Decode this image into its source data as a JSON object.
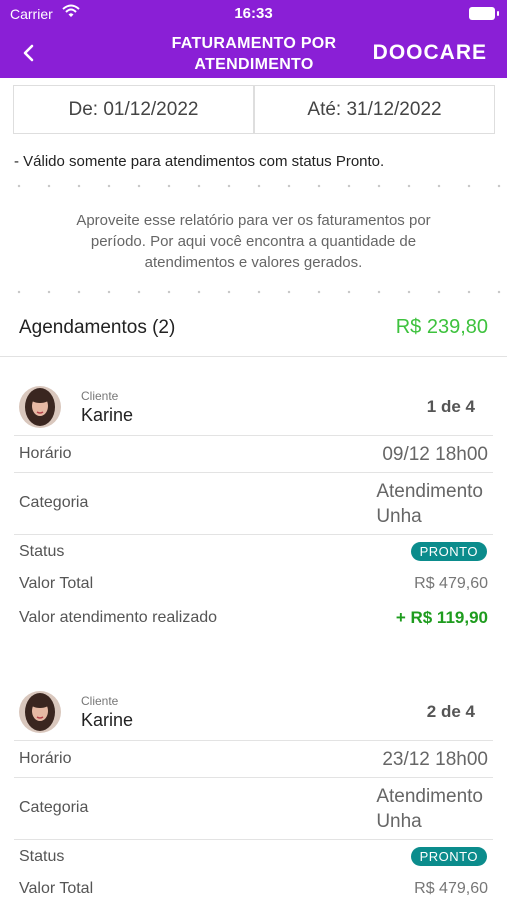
{
  "status_bar": {
    "carrier": "Carrier",
    "time": "16:33"
  },
  "nav": {
    "title_line1": "FATURAMENTO POR",
    "title_line2": "ATENDIMENTO",
    "brand": "DOOCARE"
  },
  "date_filter": {
    "from_label": "De: 01/12/2022",
    "to_label": "Até: 31/12/2022"
  },
  "note": "- Válido somente para atendimentos com status Pronto.",
  "intro": {
    "line1": "Aproveite esse relatório para ver os faturamentos por",
    "line2": "período. Por aqui você encontra a quantidade de",
    "line3": "atendimentos e valores gerados."
  },
  "summary": {
    "label": "Agendamentos (2)",
    "total": "R$ 239,80"
  },
  "labels": {
    "client": "Cliente",
    "time": "Horário",
    "category": "Categoria",
    "status": "Status",
    "total": "Valor Total",
    "realized": "Valor atendimento realizado"
  },
  "appointments": [
    {
      "client_name": "Karine",
      "counter": "1 de 4",
      "time": "09/12 18h00",
      "category_line1": "Atendimento",
      "category_line2": "Unha",
      "status": "PRONTO",
      "total": "R$ 479,60",
      "realized": "+ R$ 119,90"
    },
    {
      "client_name": "Karine",
      "counter": "2 de 4",
      "time": "23/12 18h00",
      "category_line1": "Atendimento",
      "category_line2": "Unha",
      "status": "PRONTO",
      "total": "R$ 479,60"
    }
  ],
  "icons": {
    "back": "chevron-left-icon",
    "wifi": "wifi-icon",
    "battery": "battery-icon",
    "avatar": "avatar"
  },
  "colors": {
    "header": "#8a1fd6",
    "summary_total": "#3ec23e",
    "realized_value": "#1e9c1e",
    "status_badge": "#0b8c8c"
  }
}
